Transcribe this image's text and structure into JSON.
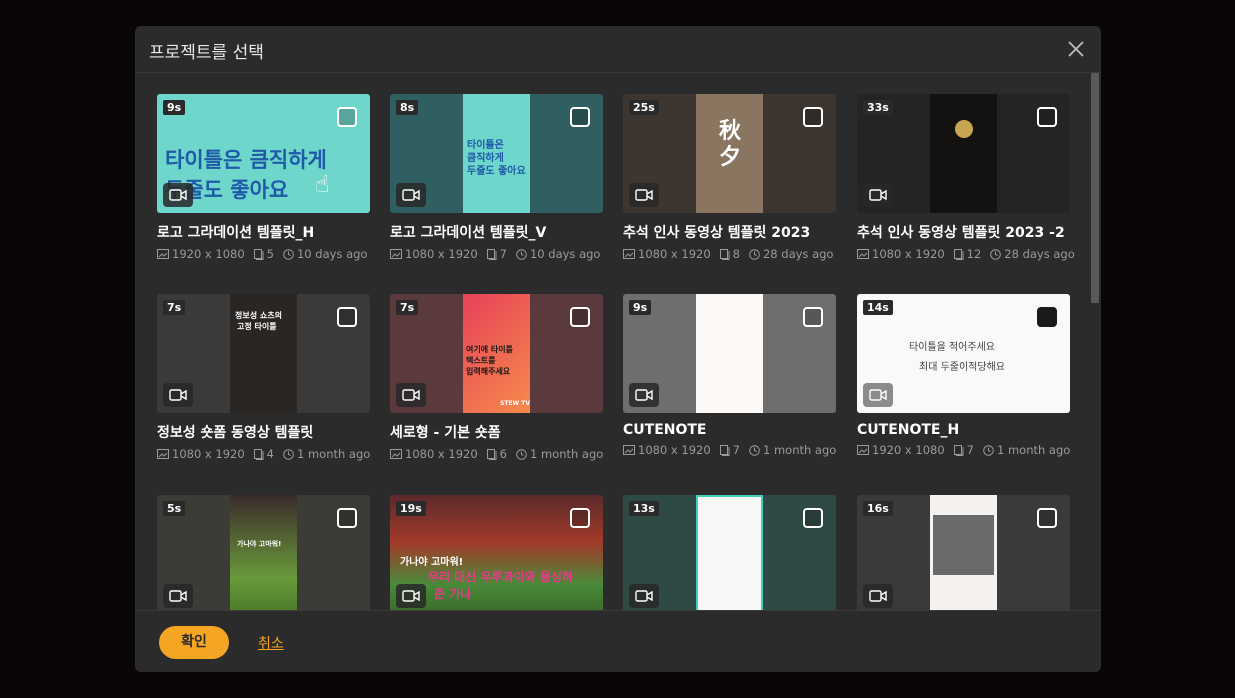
{
  "dialog": {
    "title": "프로젝트를 선택",
    "confirm_label": "확인",
    "cancel_label": "취소"
  },
  "icons": {
    "close": "close-icon",
    "video": "video-camera-icon",
    "resolution": "image-size-icon",
    "pages": "pages-icon",
    "time": "clock-icon"
  },
  "colors": {
    "accent": "#f5a524",
    "panel": "#2b2b2b"
  },
  "projects": [
    {
      "duration": "9s",
      "title": "로고 그라데이션 템플릿_H",
      "resolution": "1920 x 1080",
      "pages": "5",
      "age": "10 days ago",
      "thumb_text_1": "타이틀은 큼직하게",
      "thumb_text_2": "두줄도 좋아요"
    },
    {
      "duration": "8s",
      "title": "로고 그라데이션 템플릿_V",
      "resolution": "1080 x 1920",
      "pages": "7",
      "age": "10 days ago",
      "thumb_text_1": "타이틀은",
      "thumb_text_2": "큼직하게",
      "thumb_text_3": "두줄도 좋아요"
    },
    {
      "duration": "25s",
      "title": "추석 인사 동영상 템플릿 2023",
      "resolution": "1080 x 1920",
      "pages": "8",
      "age": "28 days ago",
      "thumb_text_1": "秋夕"
    },
    {
      "duration": "33s",
      "title": "추석 인사 동영상 템플릿 2023 -2",
      "resolution": "1080 x 1920",
      "pages": "12",
      "age": "28 days ago"
    },
    {
      "duration": "7s",
      "title": "정보성 숏폼 동영상 템플릿",
      "resolution": "1080 x 1920",
      "pages": "4",
      "age": "1 month ago",
      "thumb_text_1": "정보성 쇼츠의",
      "thumb_text_2": "고정 타이틀"
    },
    {
      "duration": "7s",
      "title": "세로형 - 기본 숏폼",
      "resolution": "1080 x 1920",
      "pages": "6",
      "age": "1 month ago",
      "thumb_text_1": "여기에 타이틀",
      "thumb_text_2": "텍스트를",
      "thumb_text_3": "입력해주세요",
      "thumb_text_4": "STEW TV"
    },
    {
      "duration": "9s",
      "title": "CUTENOTE",
      "resolution": "1080 x 1920",
      "pages": "7",
      "age": "1 month ago"
    },
    {
      "duration": "14s",
      "title": "CUTENOTE_H",
      "resolution": "1920 x 1080",
      "pages": "7",
      "age": "1 month ago",
      "thumb_text_1": "타이틀을 적어주세요",
      "thumb_text_2": "최대 두줄이적당해요"
    },
    {
      "duration": "5s",
      "thumb_text_1": "가나야 고마워!"
    },
    {
      "duration": "19s",
      "thumb_text_1": "가나야 고마워!",
      "thumb_text_2": "우리 대신 우루과이와 울싱하",
      "thumb_text_3": "준 가나"
    },
    {
      "duration": "13s"
    },
    {
      "duration": "16s"
    }
  ]
}
